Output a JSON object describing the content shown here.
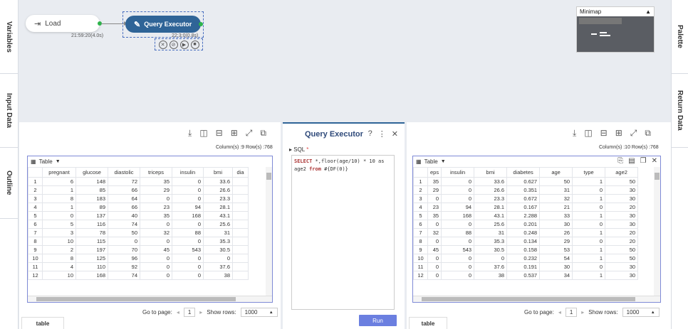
{
  "left_sidebar": {
    "tabs": [
      "Variables",
      "Input Data",
      "Outline"
    ]
  },
  "right_sidebar": {
    "tabs": [
      "Palette",
      "Return Data"
    ]
  },
  "canvas": {
    "load_node": {
      "label": "Load",
      "time": "21:59:20(4.0s)"
    },
    "qe_node": {
      "label": "Query Executor",
      "time": "22:3:0(0.8s)"
    },
    "minimap": {
      "title": "Minimap"
    }
  },
  "left_panel": {
    "info": "Column(s) :9   Row(s) :768",
    "table_label": "Table",
    "columns": [
      "pregnant",
      "glucose",
      "diastolic",
      "triceps",
      "insulin",
      "bmi",
      "dia"
    ],
    "rows": [
      [
        "1",
        "6",
        "148",
        "72",
        "35",
        "0",
        "33.6",
        ""
      ],
      [
        "2",
        "1",
        "85",
        "66",
        "29",
        "0",
        "26.6",
        ""
      ],
      [
        "3",
        "8",
        "183",
        "64",
        "0",
        "0",
        "23.3",
        ""
      ],
      [
        "4",
        "1",
        "89",
        "66",
        "23",
        "94",
        "28.1",
        ""
      ],
      [
        "5",
        "0",
        "137",
        "40",
        "35",
        "168",
        "43.1",
        ""
      ],
      [
        "6",
        "5",
        "116",
        "74",
        "0",
        "0",
        "25.6",
        ""
      ],
      [
        "7",
        "3",
        "78",
        "50",
        "32",
        "88",
        "31",
        ""
      ],
      [
        "8",
        "10",
        "115",
        "0",
        "0",
        "0",
        "35.3",
        ""
      ],
      [
        "9",
        "2",
        "197",
        "70",
        "45",
        "543",
        "30.5",
        ""
      ],
      [
        "10",
        "8",
        "125",
        "96",
        "0",
        "0",
        "0",
        ""
      ],
      [
        "11",
        "4",
        "110",
        "92",
        "0",
        "0",
        "37.6",
        ""
      ],
      [
        "12",
        "10",
        "168",
        "74",
        "0",
        "0",
        "38",
        ""
      ]
    ],
    "goto_label": "Go to page:",
    "page": "1",
    "show_rows_label": "Show rows:",
    "rows_per_page": "1000",
    "bottom_tab": "table"
  },
  "query_executor": {
    "title": "Query Executor",
    "sql_label": "SQL",
    "sql_required": "*",
    "sql_line1_kw": "SELECT",
    "sql_line1_rest": " *,floor(age/10) * 10 as",
    "sql_line2_rest": "age2 ",
    "sql_line2_kw": "from",
    "sql_line2_tail": " #{DF(0)}",
    "run_label": "Run"
  },
  "right_panel": {
    "info": "Column(s) :10   Row(s) :768",
    "table_label": "Table",
    "columns": [
      "eps",
      "insulin",
      "bmi",
      "diabetes",
      "age",
      "type",
      "age2"
    ],
    "rows": [
      [
        "1",
        "35",
        "0",
        "33.6",
        "0.627",
        "50",
        "1",
        "50"
      ],
      [
        "2",
        "29",
        "0",
        "26.6",
        "0.351",
        "31",
        "0",
        "30"
      ],
      [
        "3",
        "0",
        "0",
        "23.3",
        "0.672",
        "32",
        "1",
        "30"
      ],
      [
        "4",
        "23",
        "94",
        "28.1",
        "0.167",
        "21",
        "0",
        "20"
      ],
      [
        "5",
        "35",
        "168",
        "43.1",
        "2.288",
        "33",
        "1",
        "30"
      ],
      [
        "6",
        "0",
        "0",
        "25.6",
        "0.201",
        "30",
        "0",
        "30"
      ],
      [
        "7",
        "32",
        "88",
        "31",
        "0.248",
        "26",
        "1",
        "20"
      ],
      [
        "8",
        "0",
        "0",
        "35.3",
        "0.134",
        "29",
        "0",
        "20"
      ],
      [
        "9",
        "45",
        "543",
        "30.5",
        "0.158",
        "53",
        "1",
        "50"
      ],
      [
        "10",
        "0",
        "0",
        "0",
        "0.232",
        "54",
        "1",
        "50"
      ],
      [
        "11",
        "0",
        "0",
        "37.6",
        "0.191",
        "30",
        "0",
        "30"
      ],
      [
        "12",
        "0",
        "0",
        "38",
        "0.537",
        "34",
        "1",
        "30"
      ]
    ],
    "goto_label": "Go to page:",
    "page": "1",
    "show_rows_label": "Show rows:",
    "rows_per_page": "1000",
    "bottom_tab": "table"
  },
  "colors": {
    "node_blue": "#2f6497",
    "run_button": "#6b7fe0",
    "table_border": "#7f8ad6"
  }
}
